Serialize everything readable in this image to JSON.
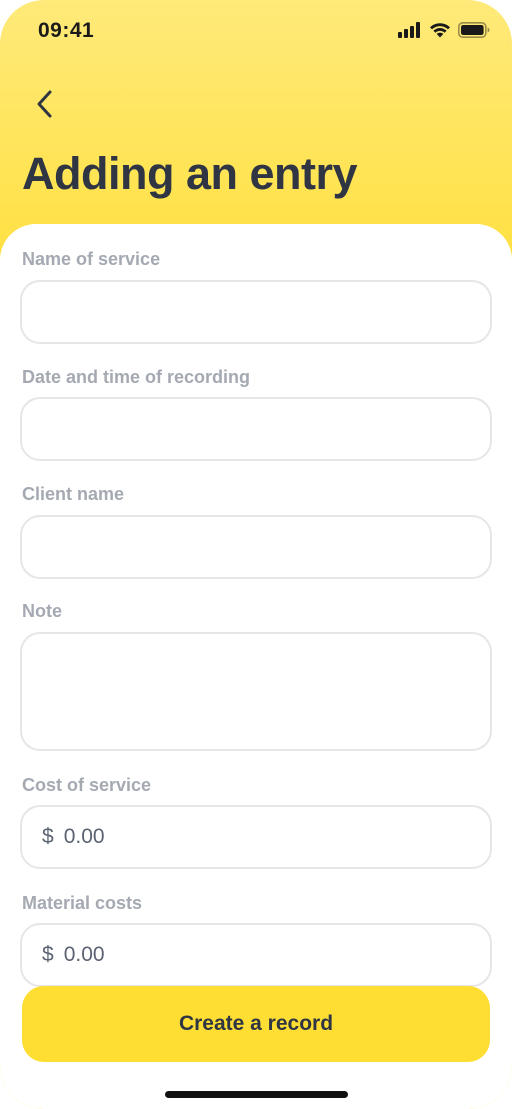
{
  "status_bar": {
    "time": "09:41",
    "icons": [
      "cellular-signal-icon",
      "wifi-icon",
      "battery-icon"
    ]
  },
  "header": {
    "back_icon": "chevron-left-icon",
    "title": "Adding an entry"
  },
  "form": {
    "service_name": {
      "label": "Name of service",
      "value": ""
    },
    "datetime": {
      "label": "Date and time of recording",
      "value": ""
    },
    "client_name": {
      "label": "Client name",
      "value": ""
    },
    "note": {
      "label": "Note",
      "value": ""
    },
    "service_cost": {
      "label": "Cost of service",
      "currency": "$",
      "value": "0.00"
    },
    "material_costs": {
      "label": "Material costs",
      "currency": "$",
      "value": "0.00"
    }
  },
  "actions": {
    "create_label": "Create a record"
  },
  "colors": {
    "accent": "#ffde33",
    "title_text": "#2f3542",
    "label_text": "#a4a9b2",
    "field_border": "#e6e6e8"
  }
}
